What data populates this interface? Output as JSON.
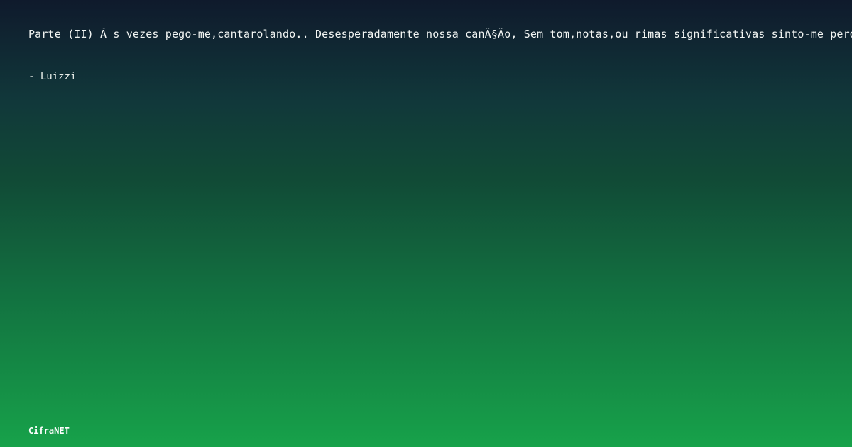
{
  "quote": {
    "text": "Parte (II) Ã s vezes pego-me,cantarolando.. Desesperadamente nossa canÃ§Ão, Sem tom,notas,ou rimas significativas sinto-me perdi"
  },
  "author": {
    "line": "- Luizzi"
  },
  "footer": {
    "brand": "CifraNET"
  },
  "colors": {
    "gradient_top": "#0f1a2c",
    "gradient_bottom": "#17a24a",
    "text": "#ffffff"
  }
}
